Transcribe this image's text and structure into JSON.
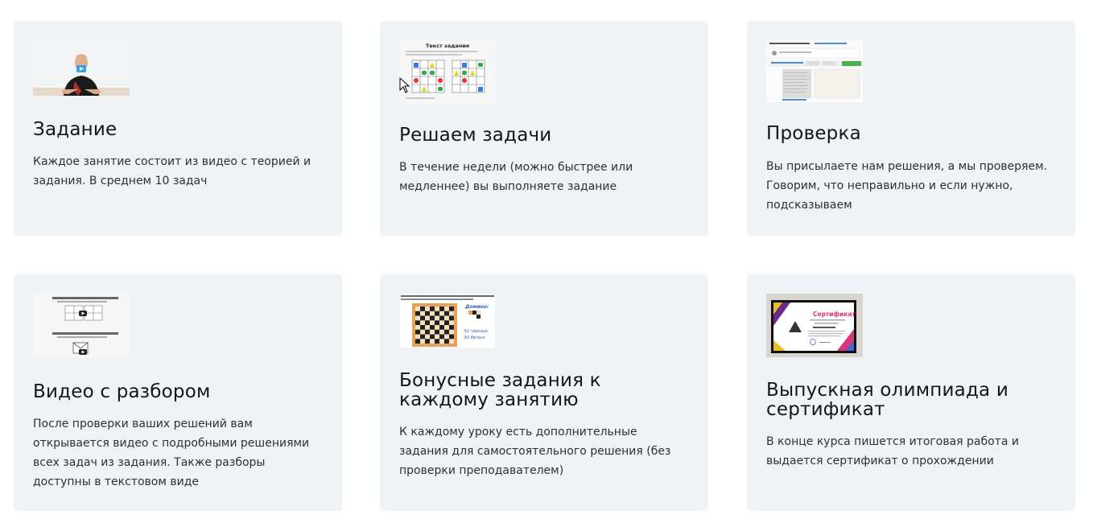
{
  "cards": [
    {
      "title": "Задание",
      "text": "Каждое занятие состоит из видео с теорией и задания. В среднем 10 задач",
      "icon": "teacher-video-thumbnail"
    },
    {
      "title": "Решаем задачи",
      "text": "В течение недели (можно быстрее или медленнее) вы выполняете задание",
      "icon": "puzzle-grid-thumbnail",
      "thumb_heading": "Текст задания"
    },
    {
      "title": "Проверка",
      "text": "Вы присылаете нам решения, а мы проверяем. Говорим, что неправильно и если нужно, подсказываем",
      "icon": "review-comments-thumbnail"
    },
    {
      "title": "Видео с разбором",
      "text": "После проверки ваших решений вам открывается видео с подробными решениями всех задач из задания. Также разборы доступны в текстовом виде",
      "icon": "solution-video-thumbnail"
    },
    {
      "title": "Бонусные задания к каждому занятию",
      "text": "К каждому уроку есть дополнительные задания для самостоятельного решения (без проверки преподавателем)",
      "icon": "chessboard-thumbnail",
      "thumb_heading": "Домино:",
      "thumb_line1": "32 чёрных",
      "thumb_line2": "30 белых"
    },
    {
      "title": "Выпускная олимпиада и сертификат",
      "text": "В конце курса пишется итоговая работа и выдается сертификат о прохождении",
      "icon": "certificate-thumbnail",
      "thumb_heading": "Сертификат"
    }
  ],
  "colors": {
    "card_bg": "#f0f3f6",
    "title": "#151515",
    "text": "#2f2f2f"
  }
}
